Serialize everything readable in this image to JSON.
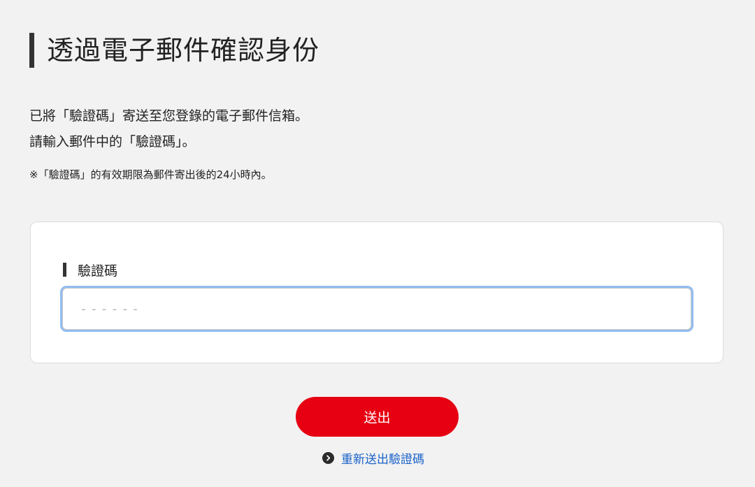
{
  "page": {
    "title": "透過電子郵件確認身份"
  },
  "description": {
    "line1": "已將「驗證碼」寄送至您登錄的電子郵件信箱。",
    "line2": "請輸入郵件中的「驗證碼」。"
  },
  "note": "※「驗證碼」的有效期限為郵件寄出後的24小時內。",
  "form": {
    "field_label": "驗證碼",
    "input_value": "",
    "input_placeholder": "------"
  },
  "actions": {
    "submit_label": "送出",
    "resend_label": "重新送出驗證碼",
    "resend_icon": "chevron-right-circle-icon"
  },
  "colors": {
    "page_background": "#f2f2f2",
    "primary_button": "#e60012",
    "link": "#1a62c8",
    "input_focus_ring": "#93bdf0"
  }
}
